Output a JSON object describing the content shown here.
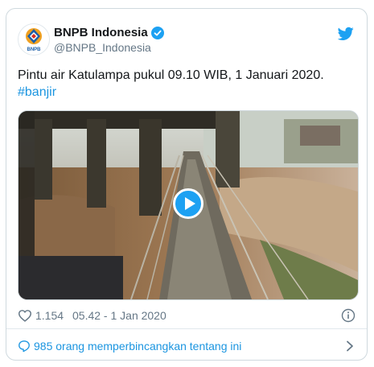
{
  "tweet": {
    "author": {
      "display_name": "BNPB Indonesia",
      "handle": "@BNPB_Indonesia",
      "avatar_label": "BNPB",
      "verified_icon": "verified-badge-icon"
    },
    "platform_icon": "twitter-bird-icon",
    "text_main": "Pintu air Katulampa pukul 09.10 WIB, 1 Januari 2020.",
    "hashtag": "#banjir",
    "media": {
      "type": "video",
      "play_icon": "play-icon"
    },
    "likes": "1.154",
    "timestamp": "05.42 - 1 Jan 2020",
    "info_icon": "info-icon",
    "footer": {
      "label": "985 orang memperbincangkan tentang ini",
      "icon": "comment-bubble-icon",
      "chevron": "chevron-right-icon"
    },
    "colors": {
      "link": "#1b95e0",
      "text": "#14171a",
      "secondary": "#657786",
      "brand_orange": "#e8742a"
    }
  }
}
